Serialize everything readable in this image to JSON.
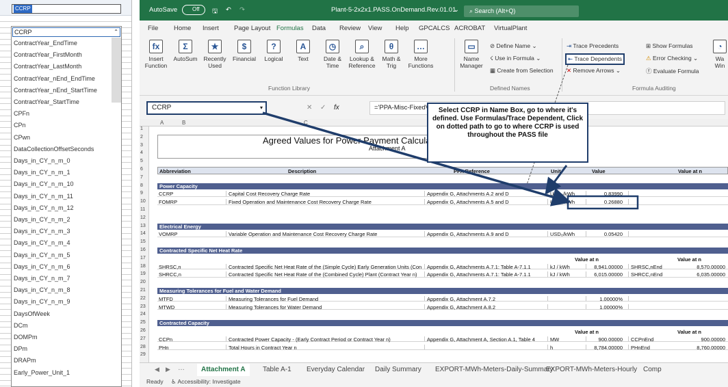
{
  "left_pane": {
    "name_box": "CCRP",
    "dropdown_current": "CCRP",
    "items": [
      "ContractYear_EndTime",
      "ContractYear_FirstMonth",
      "ContractYear_LastMonth",
      "ContractYear_nEnd_EndTime",
      "ContractYear_nEnd_StartTime",
      "ContractYear_StartTime",
      "CPFn",
      "CPn",
      "CPwn",
      "DataCollectionOffsetSeconds",
      "Days_in_CY_n_m_0",
      "Days_in_CY_n_m_1",
      "Days_in_CY_n_m_10",
      "Days_in_CY_n_m_11",
      "Days_in_CY_n_m_12",
      "Days_in_CY_n_m_2",
      "Days_in_CY_n_m_3",
      "Days_in_CY_n_m_4",
      "Days_in_CY_n_m_5",
      "Days_in_CY_n_m_6",
      "Days_in_CY_n_m_7",
      "Days_in_CY_n_m_8",
      "Days_in_CY_n_m_9",
      "DaysOfWeek",
      "DCm",
      "DOMPm",
      "DPm",
      "DRAPm",
      "Early_Power_Unit_1"
    ]
  },
  "title_bar": {
    "autosave": "AutoSave",
    "toggle": "Off",
    "filename": "Plant-5-2x2x1.PASS.OnDemand.Rev.01.01",
    "search": "Search (Alt+Q)"
  },
  "ribbon_tabs": [
    "File",
    "Home",
    "Insert",
    "Page Layout",
    "Formulas",
    "Data",
    "Review",
    "View",
    "Help",
    "GPCALCS",
    "ACROBAT",
    "VirtualPlant"
  ],
  "ribbon": {
    "fl_buttons": [
      {
        "l": "Insert Function",
        "i": "fx"
      },
      {
        "l": "AutoSum",
        "i": "Σ"
      },
      {
        "l": "Recently Used",
        "i": "★"
      },
      {
        "l": "Financial",
        "i": "$"
      },
      {
        "l": "Logical",
        "i": "?"
      },
      {
        "l": "Text",
        "i": "A"
      },
      {
        "l": "Date & Time",
        "i": "◷"
      },
      {
        "l": "Lookup & Reference",
        "i": "⌕"
      },
      {
        "l": "Math & Trig",
        "i": "θ"
      },
      {
        "l": "More Functions",
        "i": "…"
      }
    ],
    "function_library": "Function Library",
    "name_manager": "Name Manager",
    "define_name": "Define Name",
    "use_in_formula": "Use in Formula",
    "create_from_selection": "Create from Selection",
    "defined_names": "Defined Names",
    "trace_precedents": "Trace Precedents",
    "trace_dependents": "Trace Dependents",
    "remove_arrows": "Remove Arrows",
    "show_formulas": "Show Formulas",
    "error_checking": "Error Checking",
    "evaluate_formula": "Evaluate Formula",
    "formula_auditing": "Formula Auditing",
    "watch": "Wa Win"
  },
  "formula_bar": {
    "name_box": "CCRP",
    "fx": "fx",
    "formula": "='PPA-Misc-FixedValues'!$D$43"
  },
  "callout": "Select CCRP in Name Box, go to where it's defined.  Use Formulas/Trace Dependent, Click on dotted path to go to where CCRP is used throughout the PASS file",
  "sheet": {
    "columns": [
      "A",
      "B",
      "C",
      "D",
      "E"
    ],
    "title": "Agreed Values for Power Payment Calculation",
    "subtitle": "Attachment A",
    "header": {
      "abbr": "Abbreviation",
      "desc": "Description",
      "ref": "PPA Reference",
      "unit": "Unit",
      "value": "Value",
      "value_n": "Value at n"
    },
    "sections": {
      "power_capacity": "Power Capacity",
      "electrical_energy": "Electrical Energy",
      "contracted_heat_rate": "Contracted Specific Net Heat Rate",
      "tolerances": "Measuring Tolerances for Fuel and Water Demand",
      "contracted_capacity": "Contracted Capacity"
    },
    "rows": [
      {
        "r": "9",
        "a": "CCRP",
        "d": "Capital Cost Recovery Charge Rate",
        "p": "Appendix G, Attachments A.2 and D",
        "u": "USD₀/kWh",
        "v": "0.83990"
      },
      {
        "r": "10",
        "a": "FOMRP",
        "d": "Fixed Operation and Maintenance Cost Recovery Charge Rate",
        "p": "Appendix G, Attachments A.5 and D",
        "u": "USD₀/kWh",
        "v": "0.26880"
      },
      {
        "r": "14",
        "a": "VOMRP",
        "d": "Variable Operation and Maintenance Cost Recovery Charge Rate",
        "p": "Appendix G, Attachments A.9 and D",
        "u": "USD₀/kWh",
        "v": "0.05420"
      },
      {
        "r": "18",
        "a": "SHRSC,n",
        "d": "Contracted Specific Net Heat Rate of the (Simple Cycle) Early Generation Units (Con",
        "p": "Appendix G, Attachments A.7.1: Table A-7.1.1",
        "u": "kJ / kWh",
        "v": "8,941.00000",
        "e": "SHRSC,nEnd",
        "f": "8,570.00000"
      },
      {
        "r": "19",
        "a": "SHRCC,n",
        "d": "Contracted Specific Net Heat Rate of the (Combined Cycle) Plant (Contract Year n)",
        "p": "Appendix G, Attachments A.7.1: Table A-7.1.1",
        "u": "kJ / kWh",
        "v": "6,015.00000",
        "e": "SHRCC,nEnd",
        "f": "6,035.00000"
      },
      {
        "r": "22",
        "a": "MTFD",
        "d": "Measuring Tolerances for Fuel Demand",
        "p": "Appendix G, Attachment A.7.2",
        "u": "",
        "v": "1.00000%"
      },
      {
        "r": "23",
        "a": "MTWD",
        "d": "Measuring Tolerances for Water Demand",
        "p": "Appendix G, Attachment A.8.2",
        "u": "",
        "v": "1.00000%"
      },
      {
        "r": "27",
        "a": "CCPn",
        "d": "Contracted Power Capacity - (Early Contract Period or Contract Year n)",
        "p": "Appendix G, Attachment A, Section A.1, Table 4",
        "u": "MW",
        "v": "900.00000",
        "e": "CCPnEnd",
        "f": "900.00000"
      },
      {
        "r": "28",
        "a": "PHn",
        "d": "Total Hours in Contract Year n",
        "p": "",
        "u": "h",
        "v": "8,784.00000",
        "e": "PHnEnd",
        "f": "8,760.00000"
      }
    ]
  },
  "sheet_tabs": [
    "Attachment A",
    "Table A-1",
    "Everyday Calendar",
    "Daily Summary",
    "EXPORT-MWh-Meters-Daily-Summary",
    "EXPORT-MWh-Meters-Hourly",
    "Comp"
  ],
  "status": {
    "ready": "Ready",
    "accessibility": "Accessibility: Investigate"
  }
}
